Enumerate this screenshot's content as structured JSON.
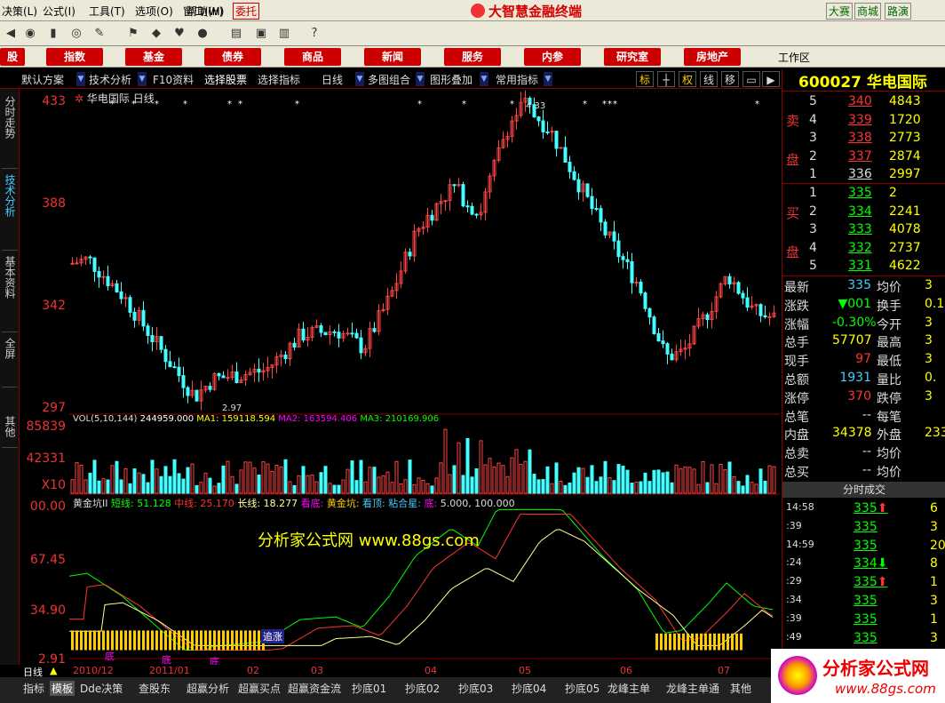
{
  "menu": {
    "items": [
      "决策(L)",
      "公式(I)",
      "工具(T)",
      "选项(O)",
      "窗口(W)",
      "帮助(H)"
    ],
    "entrust": "委托",
    "app_title": "大智慧金融终端",
    "right_buttons": [
      "大赛",
      "商城",
      "路演"
    ]
  },
  "nav": {
    "items": [
      "股",
      "指数",
      "基金",
      "债券",
      "商品",
      "新闻",
      "服务",
      "内参",
      "研究室",
      "房地产"
    ],
    "workspace": "工作区"
  },
  "chart_toolbar": {
    "items": [
      "默认方案",
      "技术分析",
      "F10资料",
      "选择股票",
      "选择指标",
      "日线",
      "多图组合",
      "图形叠加",
      "常用指标"
    ],
    "buttons": [
      "标",
      "权",
      "线",
      "移"
    ]
  },
  "left_tabs": [
    "分时走势",
    "技术分析",
    "基本资料",
    "全屏",
    "其他"
  ],
  "stock": {
    "code": "600027",
    "name": "华电国际",
    "period_label": "华电国际 日线"
  },
  "main_chart": {
    "y_ticks": [
      "433",
      "388",
      "342",
      "297"
    ],
    "high_label": "4.33",
    "low_label": "2.97"
  },
  "vol": {
    "y_ticks": [
      "85839",
      "42331",
      "X10"
    ],
    "legend": {
      "title": "VOL(5,10,144)",
      "value": "244959.000",
      "ma1": "MA1: 159118.594",
      "ma2": "MA2: 163594.406",
      "ma3": "MA3: 210169.906"
    }
  },
  "indicator": {
    "y_ticks": [
      "00.00",
      "67.45",
      "34.90",
      "2.91"
    ],
    "legend": {
      "name": "黄金坑II",
      "short": "短线: 51.128",
      "mid": "中线: 25.170",
      "long": "长线: 18.277",
      "watch_bottom": "看底:",
      "golden_pit": "黄金坑:",
      "watch_top": "看顶:",
      "sticky_star": "粘合星:",
      "bottom": "底:",
      "bottom_values": "5.000, 100.000"
    },
    "watermark": "分析家公式网 www.88gs.com",
    "marks": [
      "追涨",
      "底",
      "底",
      "底"
    ]
  },
  "x_axis": {
    "label": "日线",
    "dates": [
      "2010/12",
      "2011/01",
      "02",
      "03",
      "04",
      "05",
      "06",
      "07"
    ]
  },
  "quote": {
    "sell_label": "卖盘",
    "buy_label": "买盘",
    "sell": [
      {
        "n": "5",
        "p": "340",
        "v": "4843"
      },
      {
        "n": "4",
        "p": "339",
        "v": "1720"
      },
      {
        "n": "3",
        "p": "338",
        "v": "2773"
      },
      {
        "n": "2",
        "p": "337",
        "v": "2874"
      },
      {
        "n": "1",
        "p": "336",
        "v": "2997"
      }
    ],
    "buy": [
      {
        "n": "1",
        "p": "335",
        "v": "2"
      },
      {
        "n": "2",
        "p": "334",
        "v": "2241"
      },
      {
        "n": "3",
        "p": "333",
        "v": "4078"
      },
      {
        "n": "4",
        "p": "332",
        "v": "2737"
      },
      {
        "n": "5",
        "p": "331",
        "v": "4622"
      }
    ],
    "stats": [
      {
        "l": "最新",
        "v": "335",
        "l2": "均价",
        "v2": "3"
      },
      {
        "l": "涨跌",
        "v": "▼001",
        "l2": "换手",
        "v2": "0.1"
      },
      {
        "l": "涨幅",
        "v": "-0.30%",
        "l2": "今开",
        "v2": "3"
      },
      {
        "l": "总手",
        "v": "57707",
        "l2": "最高",
        "v2": "3"
      },
      {
        "l": "现手",
        "v": "97",
        "l2": "最低",
        "v2": "3"
      },
      {
        "l": "总额",
        "v": "1931",
        "l2": "量比",
        "v2": "0."
      },
      {
        "l": "涨停",
        "v": "370",
        "l2": "跌停",
        "v2": "3"
      },
      {
        "l": "总笔",
        "v": "--",
        "l2": "每笔",
        "v2": ""
      },
      {
        "l": "内盘",
        "v": "34378",
        "l2": "外盘",
        "v2": "233"
      },
      {
        "l": "总卖",
        "v": "--",
        "l2": "均价",
        "v2": ""
      },
      {
        "l": "总买",
        "v": "--",
        "l2": "均价",
        "v2": ""
      }
    ],
    "ticks_title": "分时成交",
    "ticks": [
      {
        "t": "14:58",
        "p": "335",
        "v": "6"
      },
      {
        "t": ":39",
        "p": "335",
        "v": "3"
      },
      {
        "t": "14:59",
        "p": "335",
        "v": "20"
      },
      {
        "t": ":24",
        "p": "334",
        "v": "8"
      },
      {
        "t": ":29",
        "p": "335",
        "v": "1"
      },
      {
        "t": ":34",
        "p": "335",
        "v": "3"
      },
      {
        "t": ":39",
        "p": "335",
        "v": "1"
      },
      {
        "t": ":49",
        "p": "335",
        "v": "3"
      }
    ]
  },
  "bottom_tabs": [
    "指标",
    "模板",
    "Dde决策",
    "查股东",
    "超赢分析",
    "超赢买点",
    "超赢资金流",
    "抄底01",
    "抄底02",
    "抄底03",
    "抄底04",
    "抄底05",
    "龙峰主单",
    "龙峰主单通",
    "其他"
  ],
  "site_logo": {
    "text": "分析家公式网",
    "url": "www.88gs.com"
  }
}
